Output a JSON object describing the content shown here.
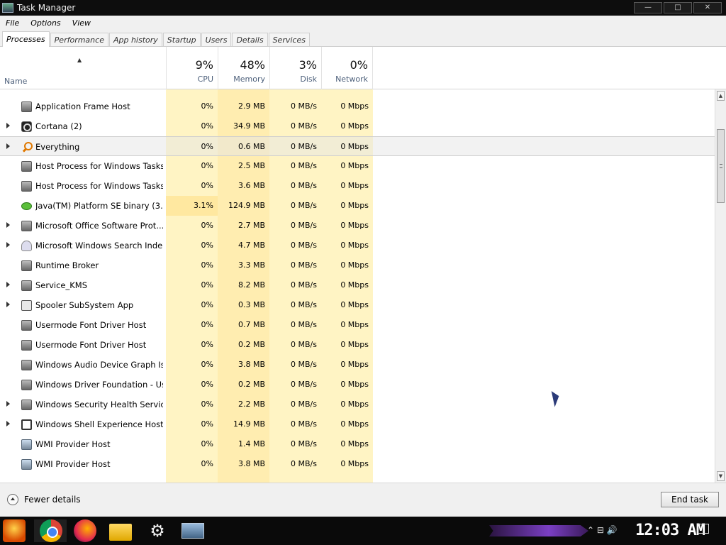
{
  "window": {
    "title": "Task Manager",
    "controls": [
      "—",
      "□",
      "✕"
    ]
  },
  "menu": [
    "File",
    "Options",
    "View"
  ],
  "tabs": [
    "Processes",
    "Performance",
    "App history",
    "Startup",
    "Users",
    "Details",
    "Services"
  ],
  "columns": {
    "name": "Name",
    "cpu": {
      "pct": "9%",
      "label": "CPU"
    },
    "memory": {
      "pct": "48%",
      "label": "Memory"
    },
    "disk": {
      "pct": "3%",
      "label": "Disk"
    },
    "network": {
      "pct": "0%",
      "label": "Network"
    }
  },
  "colors": {
    "col_bg": "#fff4c4",
    "col_bg_mem": "#ffedb0",
    "col_bg_cpu_hot": "#ffe8a0"
  },
  "processes": [
    {
      "name": "Application Frame Host",
      "cpu": "0%",
      "memory": "2.9 MB",
      "disk": "0 MB/s",
      "network": "0 Mbps",
      "expand": false,
      "icon": "app-icon"
    },
    {
      "name": "Cortana (2)",
      "cpu": "0%",
      "memory": "34.9 MB",
      "disk": "0 MB/s",
      "network": "0 Mbps",
      "expand": true,
      "icon": "cortana-icon"
    },
    {
      "name": "Everything",
      "cpu": "0%",
      "memory": "0.6 MB",
      "disk": "0 MB/s",
      "network": "0 Mbps",
      "expand": true,
      "icon": "search-icon",
      "selected": true
    },
    {
      "name": "Host Process for Windows Tasks",
      "cpu": "0%",
      "memory": "2.5 MB",
      "disk": "0 MB/s",
      "network": "0 Mbps",
      "expand": false,
      "icon": "app-icon"
    },
    {
      "name": "Host Process for Windows Tasks",
      "cpu": "0%",
      "memory": "3.6 MB",
      "disk": "0 MB/s",
      "network": "0 Mbps",
      "expand": false,
      "icon": "app-icon"
    },
    {
      "name": "Java(TM) Platform SE binary (3...",
      "cpu": "3.1%",
      "memory": "124.9 MB",
      "disk": "0 MB/s",
      "network": "0 Mbps",
      "expand": false,
      "icon": "java-icon"
    },
    {
      "name": "Microsoft Office Software Prot...",
      "cpu": "0%",
      "memory": "2.7 MB",
      "disk": "0 MB/s",
      "network": "0 Mbps",
      "expand": true,
      "icon": "app-icon"
    },
    {
      "name": "Microsoft Windows Search Inde...",
      "cpu": "0%",
      "memory": "4.7 MB",
      "disk": "0 MB/s",
      "network": "0 Mbps",
      "expand": true,
      "icon": "user-icon"
    },
    {
      "name": "Runtime Broker",
      "cpu": "0%",
      "memory": "3.3 MB",
      "disk": "0 MB/s",
      "network": "0 Mbps",
      "expand": false,
      "icon": "app-icon"
    },
    {
      "name": "Service_KMS",
      "cpu": "0%",
      "memory": "8.2 MB",
      "disk": "0 MB/s",
      "network": "0 Mbps",
      "expand": true,
      "icon": "app-icon"
    },
    {
      "name": "Spooler SubSystem App",
      "cpu": "0%",
      "memory": "0.3 MB",
      "disk": "0 MB/s",
      "network": "0 Mbps",
      "expand": true,
      "icon": "printer-icon"
    },
    {
      "name": "Usermode Font Driver Host",
      "cpu": "0%",
      "memory": "0.7 MB",
      "disk": "0 MB/s",
      "network": "0 Mbps",
      "expand": false,
      "icon": "app-icon"
    },
    {
      "name": "Usermode Font Driver Host",
      "cpu": "0%",
      "memory": "0.2 MB",
      "disk": "0 MB/s",
      "network": "0 Mbps",
      "expand": false,
      "icon": "app-icon"
    },
    {
      "name": "Windows Audio Device Graph Is...",
      "cpu": "0%",
      "memory": "3.8 MB",
      "disk": "0 MB/s",
      "network": "0 Mbps",
      "expand": false,
      "icon": "app-icon"
    },
    {
      "name": "Windows Driver Foundation - Us...",
      "cpu": "0%",
      "memory": "0.2 MB",
      "disk": "0 MB/s",
      "network": "0 Mbps",
      "expand": false,
      "icon": "app-icon"
    },
    {
      "name": "Windows Security Health Service",
      "cpu": "0%",
      "memory": "2.2 MB",
      "disk": "0 MB/s",
      "network": "0 Mbps",
      "expand": true,
      "icon": "app-icon"
    },
    {
      "name": "Windows Shell Experience Host ...",
      "cpu": "0%",
      "memory": "14.9 MB",
      "disk": "0 MB/s",
      "network": "0 Mbps",
      "expand": true,
      "icon": "window-icon"
    },
    {
      "name": "WMI Provider Host",
      "cpu": "0%",
      "memory": "1.4 MB",
      "disk": "0 MB/s",
      "network": "0 Mbps",
      "expand": false,
      "icon": "wmi-icon"
    },
    {
      "name": "WMI Provider Host",
      "cpu": "0%",
      "memory": "3.8 MB",
      "disk": "0 MB/s",
      "network": "0 Mbps",
      "expand": false,
      "icon": "wmi-icon"
    }
  ],
  "footer": {
    "fewer_details": "Fewer details",
    "end_task": "End task"
  },
  "taskbar": {
    "clock": "12:03 AM",
    "icons": [
      "start-icon",
      "chrome-icon",
      "firefox-icon",
      "folder-icon",
      "gear-icon",
      "task-manager-icon"
    ]
  }
}
